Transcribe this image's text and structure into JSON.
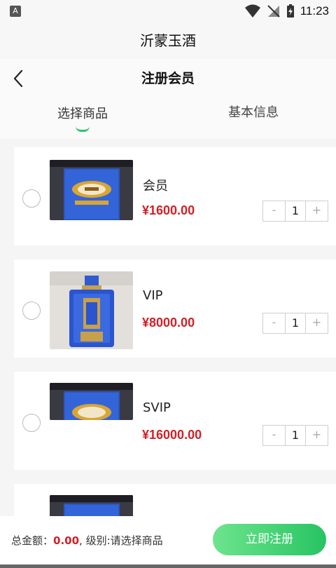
{
  "status_bar": {
    "time": "11:23"
  },
  "app_title": "沂蒙玉酒",
  "nav": {
    "title": "注册会员"
  },
  "tabs": [
    {
      "label": "选择商品",
      "active": true
    },
    {
      "label": "基本信息",
      "active": false
    }
  ],
  "products": [
    {
      "name": "会员",
      "price": "¥1600.00",
      "qty": "1",
      "image": "blue-gift-box"
    },
    {
      "name": "VIP",
      "price": "¥8000.00",
      "qty": "1",
      "image": "blue-bottle"
    },
    {
      "name": "SVIP",
      "price": "¥16000.00",
      "qty": "1",
      "image": "blue-gift-box"
    },
    {
      "name": "",
      "price": "",
      "qty": "",
      "image": "blue-gift-box"
    }
  ],
  "stepper": {
    "minus": "-",
    "plus": "+"
  },
  "footer": {
    "total_label": "总金额：",
    "total_amount": "0.00",
    "level_text": ", 级别:请选择商品",
    "submit_label": "立即注册"
  },
  "colors": {
    "accent": "#26c66a",
    "price": "#d21f26",
    "product_blue": "#2a56c6"
  }
}
